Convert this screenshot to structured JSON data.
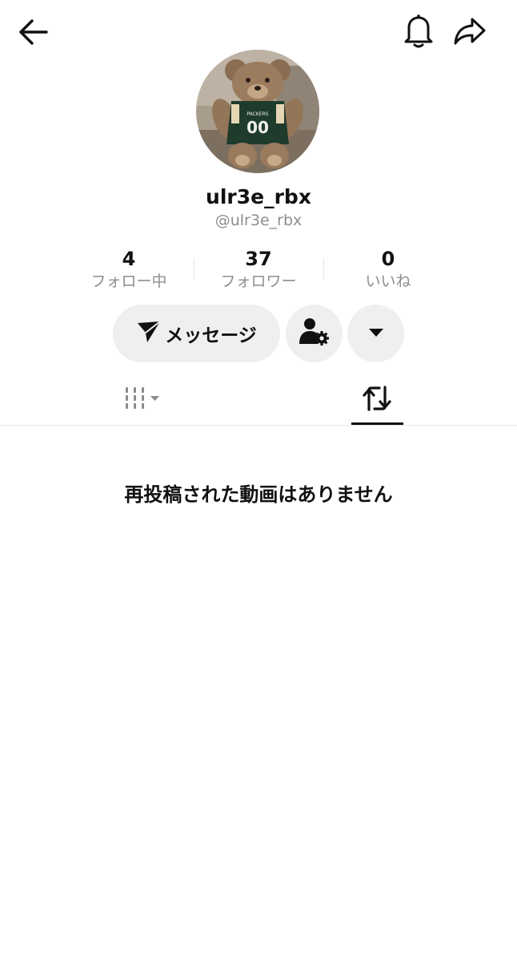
{
  "profile": {
    "display_name": "ulr3e_rbx",
    "handle": "@ulr3e_rbx",
    "avatar_description": "teddy bear wearing green PACKERS 00 jersey"
  },
  "stats": [
    {
      "value": "4",
      "label": "フォロー中"
    },
    {
      "value": "37",
      "label": "フォロワー"
    },
    {
      "value": "0",
      "label": "いいね"
    }
  ],
  "actions": {
    "message_label": "メッセージ"
  },
  "icons": {
    "back": "arrow-left-icon",
    "bell": "bell-icon",
    "share": "share-arrow-icon",
    "send": "send-plane-icon",
    "friend_settings": "user-gear-icon",
    "more": "caret-down-icon",
    "videos_tab": "grid-bars-icon",
    "reposts_tab": "repost-icon"
  },
  "tabs": {
    "active": "reposts"
  },
  "empty_state": {
    "message": "再投稿された動画はありません"
  },
  "colors": {
    "text_primary": "#111111",
    "text_secondary": "#8e8e93",
    "button_bg": "#efefef"
  }
}
